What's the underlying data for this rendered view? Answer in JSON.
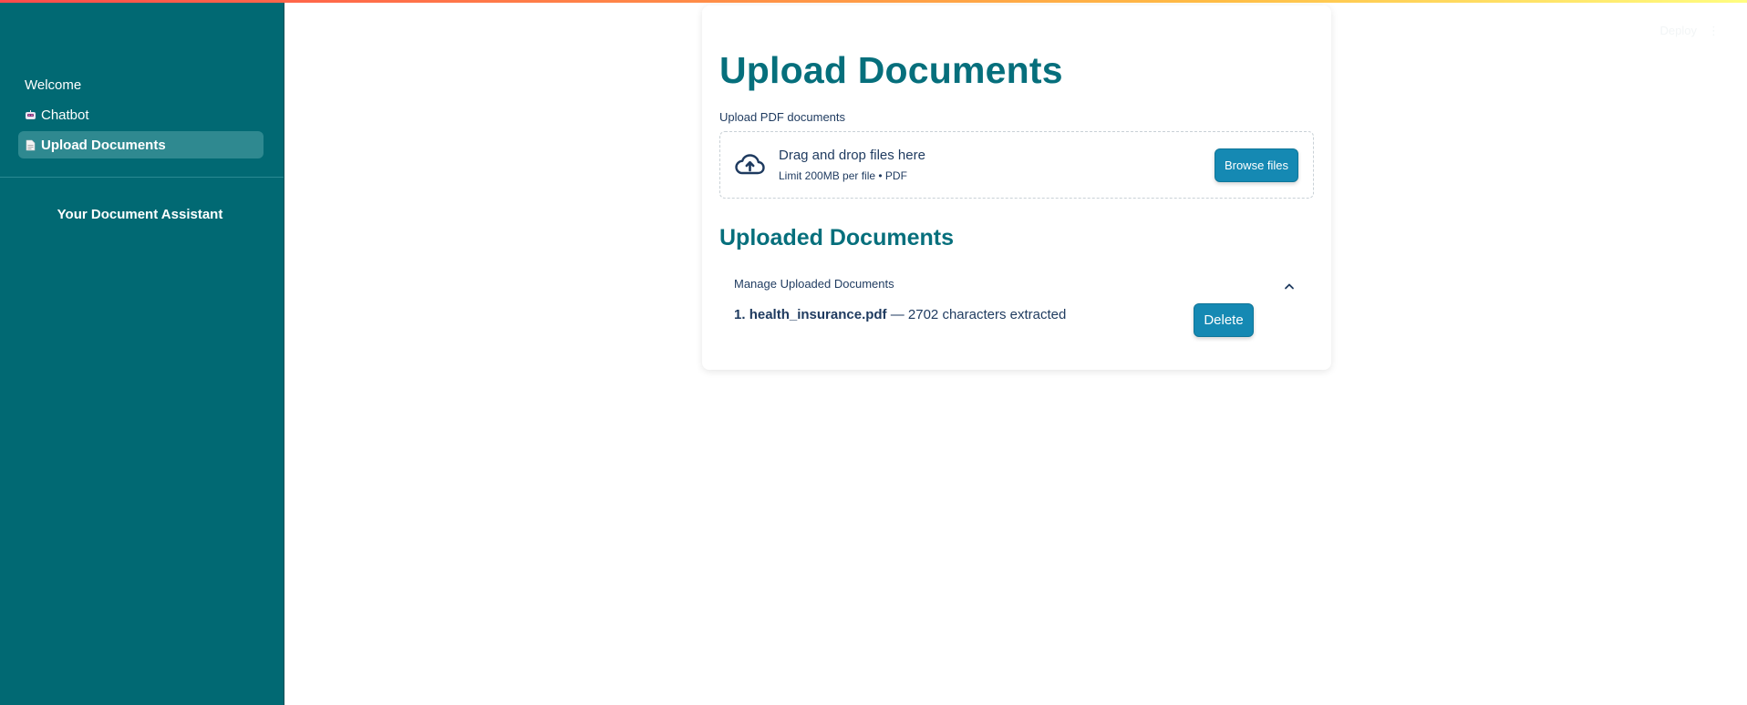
{
  "sidebar": {
    "items": [
      {
        "label": "Welcome",
        "icon": ""
      },
      {
        "label": "Chatbot",
        "icon": "robot-emoji"
      },
      {
        "label": "Upload Documents",
        "icon": "page-emoji",
        "active": true
      }
    ],
    "caption": "Your Document Assistant"
  },
  "header": {
    "deploy_label": "Deploy",
    "menu_glyph": "⋮"
  },
  "main": {
    "title": "Upload Documents",
    "uploader": {
      "label": "Upload PDF documents",
      "dropzone_title": "Drag and drop files here",
      "dropzone_sub": "Limit 200MB per file • PDF",
      "browse_label": "Browse files"
    },
    "uploaded": {
      "section_title": "Uploaded Documents",
      "expander_label": "Manage Uploaded Documents",
      "documents": [
        {
          "index": "1.",
          "name": "health_insurance.pdf",
          "detail": "— 2702 characters extracted"
        }
      ],
      "delete_label": "Delete"
    }
  },
  "colors": {
    "sidebar_bg": "#016973",
    "active_item": "#2f8990",
    "heading": "#066f7c",
    "button": "#1589b3"
  }
}
